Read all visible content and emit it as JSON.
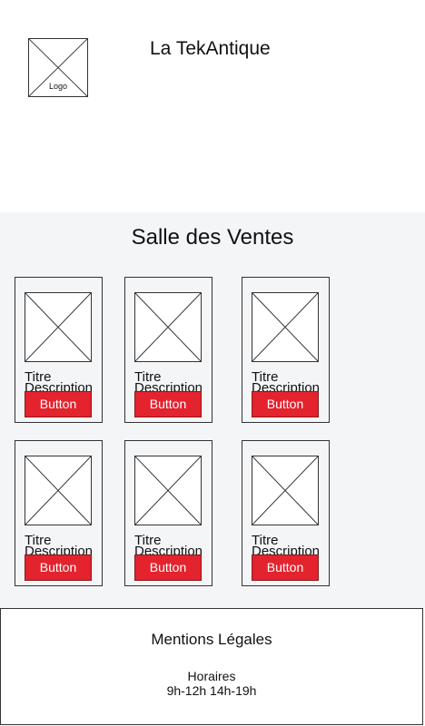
{
  "header": {
    "logo_label": "Logo",
    "site_title": "La TekAntique"
  },
  "sales": {
    "title": "Salle des Ventes",
    "cards": [
      {
        "title": "Titre",
        "description": "Description",
        "button": "Button"
      },
      {
        "title": "Titre",
        "description": "Description",
        "button": "Button"
      },
      {
        "title": "Titre",
        "description": "Description",
        "button": "Button"
      },
      {
        "title": "Titre",
        "description": "Description",
        "button": "Button"
      },
      {
        "title": "Titre",
        "description": "Description",
        "button": "Button"
      },
      {
        "title": "Titre",
        "description": "Description",
        "button": "Button"
      }
    ]
  },
  "footer": {
    "legal": "Mentions Légales",
    "hours_label": "Horaires",
    "hours_value": "9h-12h 14h-19h"
  },
  "colors": {
    "button": "#e3232e",
    "section_background": "#f4f5f7"
  }
}
